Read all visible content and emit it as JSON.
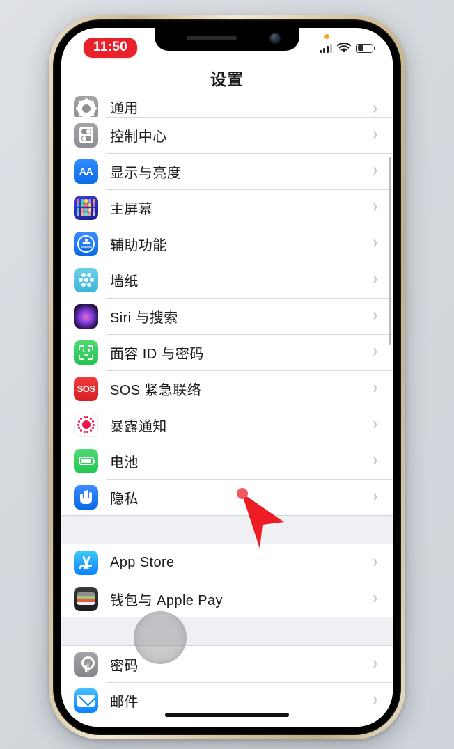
{
  "device": {
    "frame_color": "#d8c7a4",
    "background": "#d8dce0"
  },
  "status_bar": {
    "time": "11:50",
    "time_pill_color": "#e8212a",
    "mic_indicator": "orange-dot",
    "signal_icon": "cellular-signal-icon",
    "wifi_icon": "wifi-icon",
    "battery_icon": "battery-icon",
    "battery_level": "36%"
  },
  "nav": {
    "title": "设置"
  },
  "sections": [
    {
      "rows": [
        {
          "label": "通用",
          "icon": "general-gear-icon",
          "partial": true
        },
        {
          "label": "控制中心",
          "icon": "control-center-icon"
        },
        {
          "label": "显示与亮度",
          "icon": "display-brightness-icon"
        },
        {
          "label": "主屏幕",
          "icon": "home-screen-icon"
        },
        {
          "label": "辅助功能",
          "icon": "accessibility-icon"
        },
        {
          "label": "墙纸",
          "icon": "wallpaper-icon"
        },
        {
          "label": "Siri 与搜索",
          "icon": "siri-icon"
        },
        {
          "label": "面容 ID 与密码",
          "icon": "face-id-icon"
        },
        {
          "label": "SOS 紧急联络",
          "icon": "sos-icon"
        },
        {
          "label": "暴露通知",
          "icon": "exposure-notification-icon"
        },
        {
          "label": "电池",
          "icon": "battery-settings-icon"
        },
        {
          "label": "隐私",
          "icon": "privacy-hand-icon"
        }
      ]
    },
    {
      "rows": [
        {
          "label": "App Store",
          "icon": "app-store-icon"
        },
        {
          "label": "钱包与 Apple Pay",
          "icon": "wallet-icon"
        }
      ]
    },
    {
      "rows": [
        {
          "label": "密码",
          "icon": "passwords-key-icon"
        },
        {
          "label": "邮件",
          "icon": "mail-envelope-icon"
        }
      ]
    }
  ],
  "chevron": "›",
  "sos_glyph": "SOS",
  "display_glyph": "AA",
  "overlays": {
    "cursor": "red-arrow-cursor",
    "touch_indicator": "gray-touch-circle",
    "home_indicator": "home-indicator-bar",
    "scrollbar": "vertical-scrollbar"
  }
}
